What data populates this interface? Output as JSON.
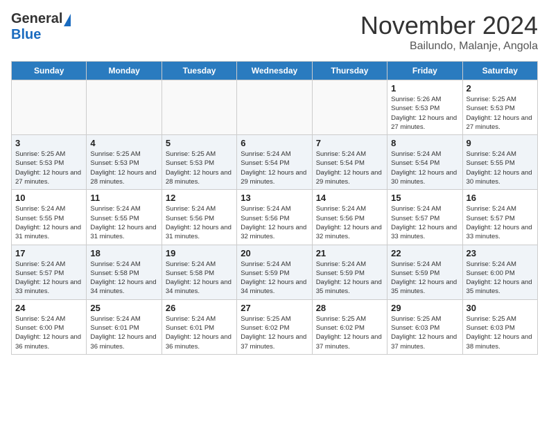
{
  "header": {
    "logo_general": "General",
    "logo_blue": "Blue",
    "month_title": "November 2024",
    "subtitle": "Bailundo, Malanje, Angola"
  },
  "days_of_week": [
    "Sunday",
    "Monday",
    "Tuesday",
    "Wednesday",
    "Thursday",
    "Friday",
    "Saturday"
  ],
  "weeks": [
    {
      "days": [
        {
          "num": "",
          "empty": true
        },
        {
          "num": "",
          "empty": true
        },
        {
          "num": "",
          "empty": true
        },
        {
          "num": "",
          "empty": true
        },
        {
          "num": "",
          "empty": true
        },
        {
          "num": "1",
          "sunrise": "5:26 AM",
          "sunset": "5:53 PM",
          "daylight": "12 hours and 27 minutes."
        },
        {
          "num": "2",
          "sunrise": "5:25 AM",
          "sunset": "5:53 PM",
          "daylight": "12 hours and 27 minutes."
        }
      ]
    },
    {
      "days": [
        {
          "num": "3",
          "sunrise": "5:25 AM",
          "sunset": "5:53 PM",
          "daylight": "12 hours and 27 minutes."
        },
        {
          "num": "4",
          "sunrise": "5:25 AM",
          "sunset": "5:53 PM",
          "daylight": "12 hours and 28 minutes."
        },
        {
          "num": "5",
          "sunrise": "5:25 AM",
          "sunset": "5:53 PM",
          "daylight": "12 hours and 28 minutes."
        },
        {
          "num": "6",
          "sunrise": "5:24 AM",
          "sunset": "5:54 PM",
          "daylight": "12 hours and 29 minutes."
        },
        {
          "num": "7",
          "sunrise": "5:24 AM",
          "sunset": "5:54 PM",
          "daylight": "12 hours and 29 minutes."
        },
        {
          "num": "8",
          "sunrise": "5:24 AM",
          "sunset": "5:54 PM",
          "daylight": "12 hours and 30 minutes."
        },
        {
          "num": "9",
          "sunrise": "5:24 AM",
          "sunset": "5:55 PM",
          "daylight": "12 hours and 30 minutes."
        }
      ]
    },
    {
      "days": [
        {
          "num": "10",
          "sunrise": "5:24 AM",
          "sunset": "5:55 PM",
          "daylight": "12 hours and 31 minutes."
        },
        {
          "num": "11",
          "sunrise": "5:24 AM",
          "sunset": "5:55 PM",
          "daylight": "12 hours and 31 minutes."
        },
        {
          "num": "12",
          "sunrise": "5:24 AM",
          "sunset": "5:56 PM",
          "daylight": "12 hours and 31 minutes."
        },
        {
          "num": "13",
          "sunrise": "5:24 AM",
          "sunset": "5:56 PM",
          "daylight": "12 hours and 32 minutes."
        },
        {
          "num": "14",
          "sunrise": "5:24 AM",
          "sunset": "5:56 PM",
          "daylight": "12 hours and 32 minutes."
        },
        {
          "num": "15",
          "sunrise": "5:24 AM",
          "sunset": "5:57 PM",
          "daylight": "12 hours and 33 minutes."
        },
        {
          "num": "16",
          "sunrise": "5:24 AM",
          "sunset": "5:57 PM",
          "daylight": "12 hours and 33 minutes."
        }
      ]
    },
    {
      "days": [
        {
          "num": "17",
          "sunrise": "5:24 AM",
          "sunset": "5:57 PM",
          "daylight": "12 hours and 33 minutes."
        },
        {
          "num": "18",
          "sunrise": "5:24 AM",
          "sunset": "5:58 PM",
          "daylight": "12 hours and 34 minutes."
        },
        {
          "num": "19",
          "sunrise": "5:24 AM",
          "sunset": "5:58 PM",
          "daylight": "12 hours and 34 minutes."
        },
        {
          "num": "20",
          "sunrise": "5:24 AM",
          "sunset": "5:59 PM",
          "daylight": "12 hours and 34 minutes."
        },
        {
          "num": "21",
          "sunrise": "5:24 AM",
          "sunset": "5:59 PM",
          "daylight": "12 hours and 35 minutes."
        },
        {
          "num": "22",
          "sunrise": "5:24 AM",
          "sunset": "5:59 PM",
          "daylight": "12 hours and 35 minutes."
        },
        {
          "num": "23",
          "sunrise": "5:24 AM",
          "sunset": "6:00 PM",
          "daylight": "12 hours and 35 minutes."
        }
      ]
    },
    {
      "days": [
        {
          "num": "24",
          "sunrise": "5:24 AM",
          "sunset": "6:00 PM",
          "daylight": "12 hours and 36 minutes."
        },
        {
          "num": "25",
          "sunrise": "5:24 AM",
          "sunset": "6:01 PM",
          "daylight": "12 hours and 36 minutes."
        },
        {
          "num": "26",
          "sunrise": "5:24 AM",
          "sunset": "6:01 PM",
          "daylight": "12 hours and 36 minutes."
        },
        {
          "num": "27",
          "sunrise": "5:25 AM",
          "sunset": "6:02 PM",
          "daylight": "12 hours and 37 minutes."
        },
        {
          "num": "28",
          "sunrise": "5:25 AM",
          "sunset": "6:02 PM",
          "daylight": "12 hours and 37 minutes."
        },
        {
          "num": "29",
          "sunrise": "5:25 AM",
          "sunset": "6:03 PM",
          "daylight": "12 hours and 37 minutes."
        },
        {
          "num": "30",
          "sunrise": "5:25 AM",
          "sunset": "6:03 PM",
          "daylight": "12 hours and 38 minutes."
        }
      ]
    }
  ]
}
